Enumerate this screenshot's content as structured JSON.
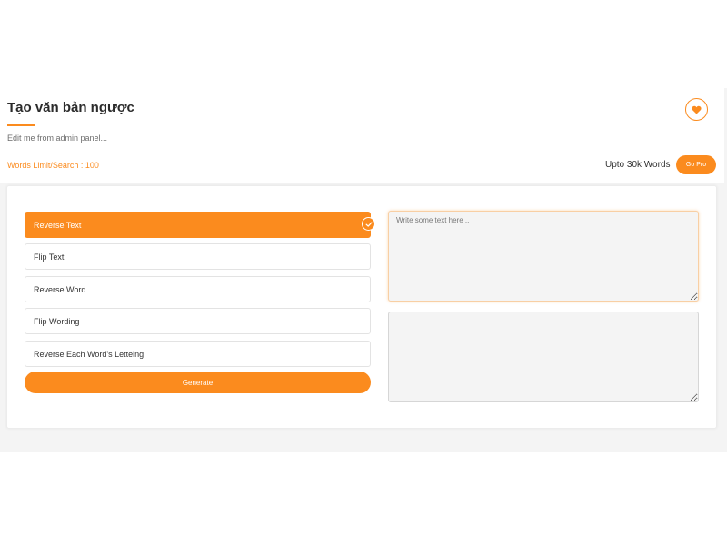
{
  "header": {
    "title": "Tạo văn bản ngược",
    "subtitle": "Edit me from admin panel...",
    "words_limit": "Words Limit/Search : 100",
    "upto_text": "Upto 30k Words",
    "go_pro_label": "Go Pro"
  },
  "options": [
    {
      "label": "Reverse Text",
      "active": true
    },
    {
      "label": "Flip Text",
      "active": false
    },
    {
      "label": "Reverse Word",
      "active": false
    },
    {
      "label": "Flip Wording",
      "active": false
    },
    {
      "label": "Reverse Each Word's Letteing",
      "active": false
    }
  ],
  "generate_label": "Generate",
  "input": {
    "placeholder": "Write some text here ..",
    "value": ""
  },
  "output": {
    "value": ""
  },
  "icons": {
    "favorite": "heart-icon",
    "selected": "check-icon"
  },
  "colors": {
    "accent": "#fb8b1e",
    "input_bg": "#f4f4f4"
  }
}
